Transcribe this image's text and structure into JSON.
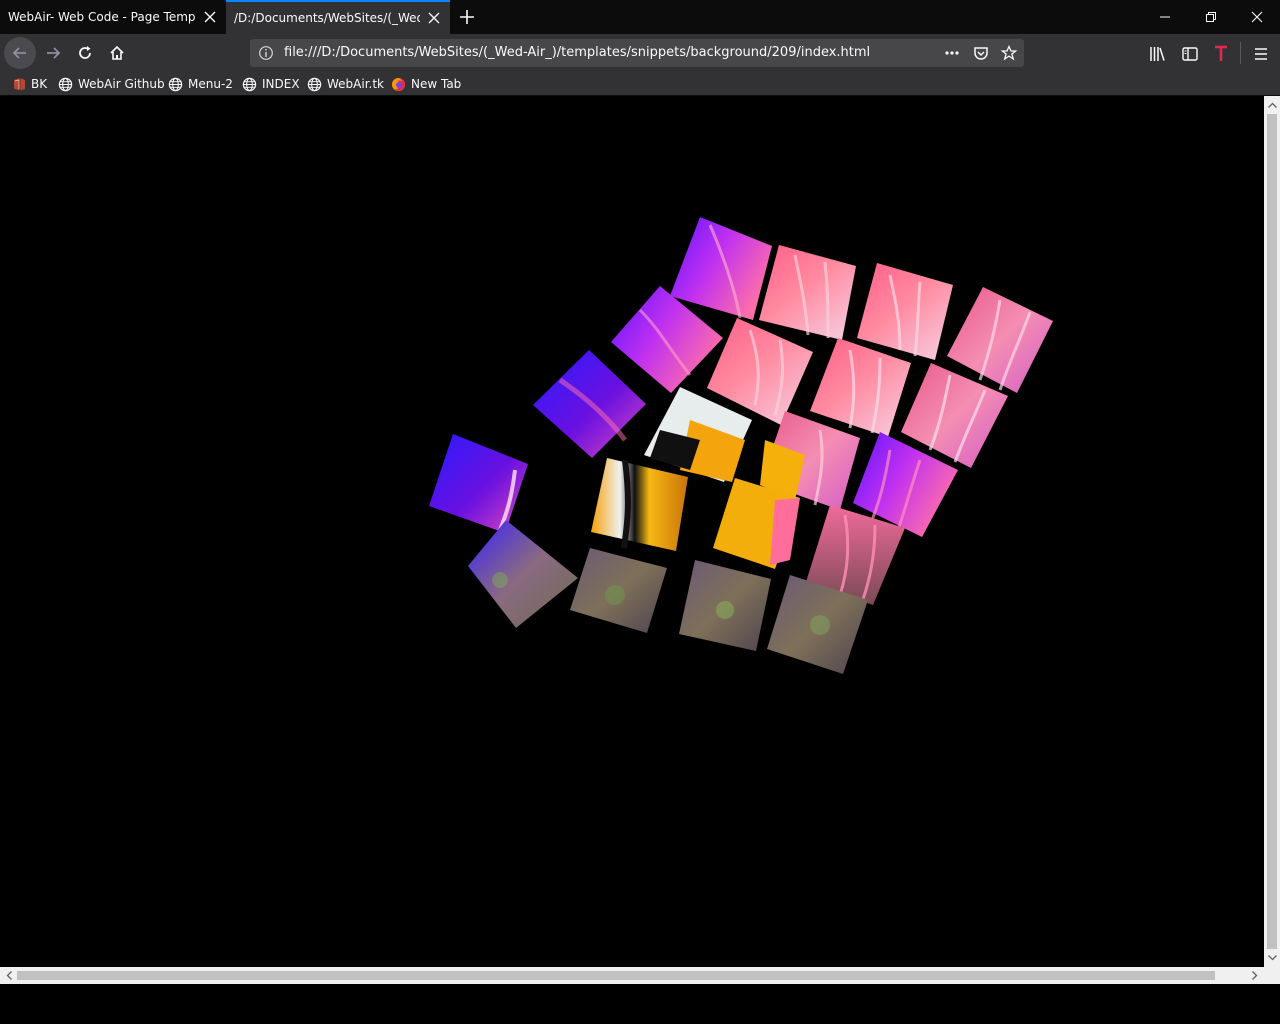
{
  "tabs": [
    {
      "label": "WebAir- Web Code - Page Templat",
      "active": false
    },
    {
      "label": "/D:/Documents/WebSites/(_Wed-A",
      "active": true
    }
  ],
  "address_bar": {
    "url": "file:///D:/Documents/WebSites/(_Wed-Air_)/templates/snippets/background/209/index.html"
  },
  "bookmarks": [
    {
      "label": "BK",
      "icon": "book-icon"
    },
    {
      "label": "WebAir Github",
      "icon": "globe-icon"
    },
    {
      "label": "Menu-2",
      "icon": "globe-icon"
    },
    {
      "label": "INDEX",
      "icon": "globe-icon"
    },
    {
      "label": "WebAir.tk",
      "icon": "globe-icon"
    },
    {
      "label": "New Tab",
      "icon": "firefox-icon"
    }
  ],
  "content": {
    "description_colors": {
      "background": "#000000",
      "anemone_pink": "#ff6e8a",
      "anemone_purple": "#c23cff",
      "deep_blue": "#2a1cff",
      "clownfish_orange": "#f5a10a"
    }
  },
  "theme": {
    "accent": "#0a84ff",
    "toolbar": "#323234",
    "tabstrip": "#0c0c0d"
  }
}
